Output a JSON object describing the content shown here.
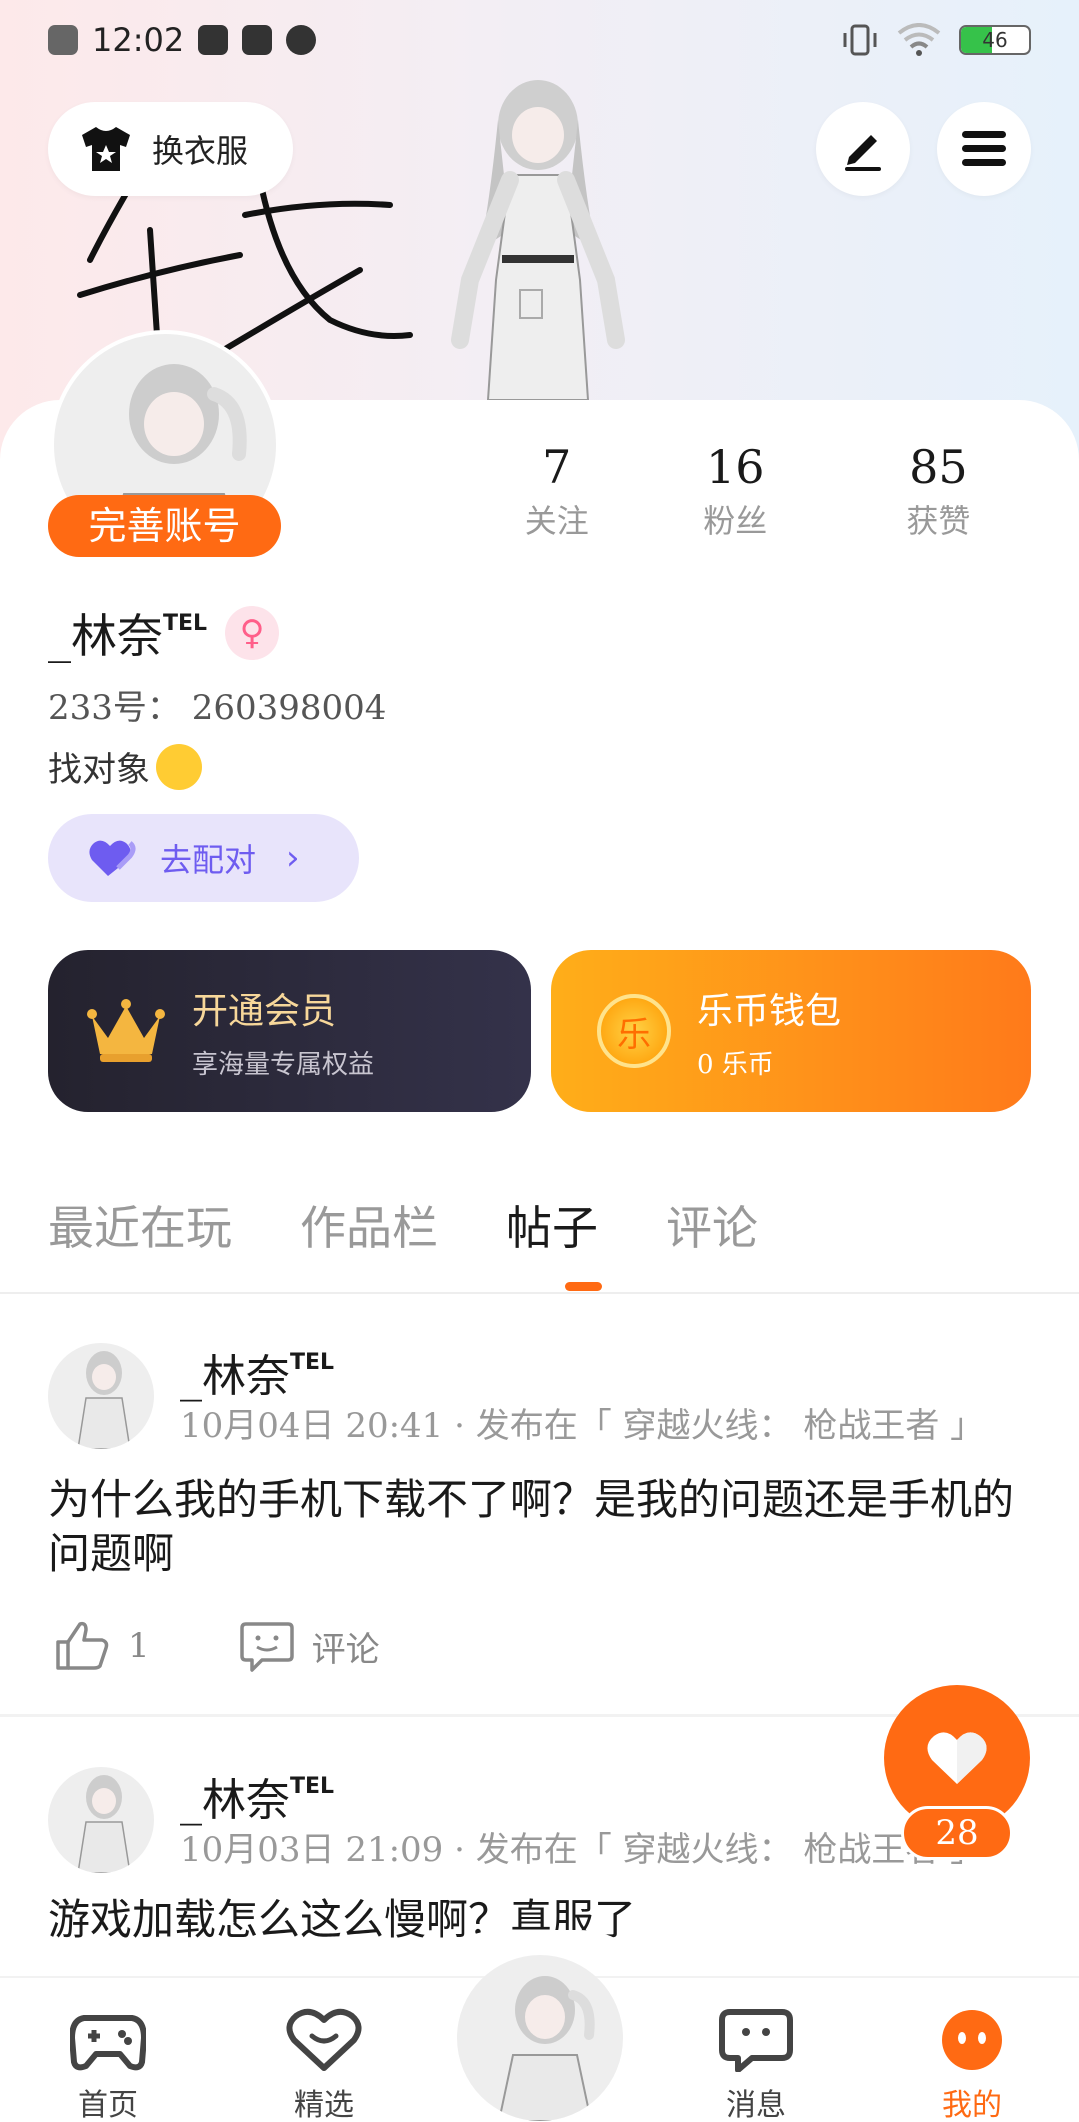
{
  "status_bar": {
    "time": "12:02",
    "battery": "46",
    "battery_level": 0.46
  },
  "header": {
    "outfit_label": "换衣服"
  },
  "profile": {
    "complete_label": "完善账号",
    "stats": [
      {
        "value": "7",
        "label": "关注"
      },
      {
        "value": "16",
        "label": "粉丝"
      },
      {
        "value": "85",
        "label": "获赞"
      }
    ],
    "username": "_林奈",
    "username_tag": "TEL",
    "gender_symbol": "♀",
    "uid": "233号： 260398004",
    "bio": "找对象",
    "match_label": "去配对"
  },
  "cards": {
    "vip": {
      "title": "开通会员",
      "subtitle": "享海量专属权益"
    },
    "wallet": {
      "title": "乐币钱包",
      "subtitle": "0 乐币",
      "coin_symbol": "乐"
    }
  },
  "tabs": [
    {
      "label": "最近在玩"
    },
    {
      "label": "作品栏"
    },
    {
      "label": "帖子"
    },
    {
      "label": "评论"
    }
  ],
  "posts": [
    {
      "user": "_林奈",
      "tag": "TEL",
      "meta": "10月04日 20:41 · 发布在「 穿越火线： 枪战王者 」",
      "body": "为什么我的手机下载不了啊？是我的问题还是手机的问题啊",
      "likes": "1",
      "comment_label": "评论"
    },
    {
      "user": "_林奈",
      "tag": "TEL",
      "meta": "10月03日 21:09 · 发布在「 穿越火线： 枪战王者 」",
      "body": "游戏加载怎么这么慢啊？真服了"
    }
  ],
  "fab": {
    "count": "28"
  },
  "nav": [
    {
      "label": "首页"
    },
    {
      "label": "精选"
    },
    {
      "label": "消息"
    },
    {
      "label": "我的"
    }
  ],
  "colors": {
    "accent": "#ff6a13",
    "match": "#6e5cf0",
    "vip_gold": "#f7d79a"
  }
}
